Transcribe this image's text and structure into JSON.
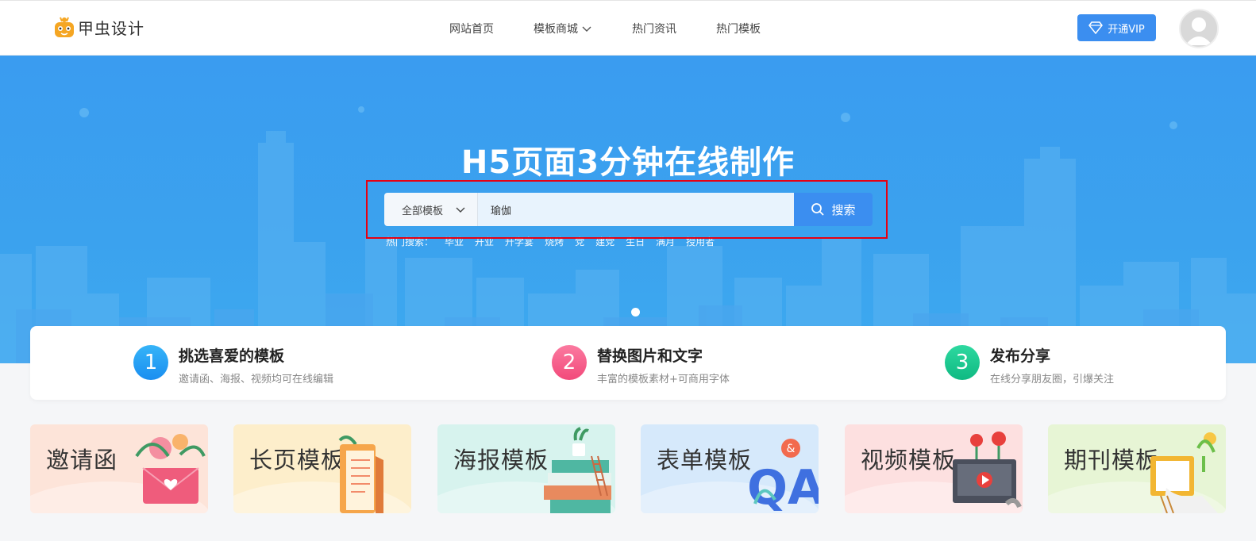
{
  "header": {
    "logo_text": "甲虫设计",
    "nav": [
      {
        "label": "网站首页"
      },
      {
        "label": "模板商城",
        "has_dropdown": true
      },
      {
        "label": "热门资讯"
      },
      {
        "label": "热门模板"
      }
    ],
    "vip_label": "开通VIP"
  },
  "hero": {
    "title": "H5页面3分钟在线制作",
    "search": {
      "category": "全部模板",
      "query": "瑜伽",
      "button_label": "搜索"
    },
    "hot_label": "热门搜索：",
    "hot_items": [
      "毕业",
      "开业",
      "升学宴",
      "烧烤",
      "党",
      "建党",
      "生日",
      "满月",
      "授用者"
    ],
    "carousel": {
      "slides_shown": 1,
      "active": 1
    }
  },
  "steps": [
    {
      "num": "1",
      "title": "挑选喜爱的模板",
      "desc": "邀请函、海报、视频均可在线编辑",
      "color": "#1e9af2"
    },
    {
      "num": "2",
      "title": "替换图片和文字",
      "desc": "丰富的模板素材+可商用字体",
      "color": "#f2557e"
    },
    {
      "num": "3",
      "title": "发布分享",
      "desc": "在线分享朋友圈，引爆关注",
      "color": "#13c28a"
    }
  ],
  "categories": [
    {
      "label": "邀请函",
      "bg": "#fde4d9",
      "icon": "envelope-icon"
    },
    {
      "label": "长页模板",
      "bg": "#fdeecb",
      "icon": "scroll-icon"
    },
    {
      "label": "海报模板",
      "bg": "#d7f3ee",
      "icon": "books-icon"
    },
    {
      "label": "表单模板",
      "bg": "#d6e9fb",
      "icon": "qa-icon"
    },
    {
      "label": "视频模板",
      "bg": "#fde0e0",
      "icon": "video-icon"
    },
    {
      "label": "期刊模板",
      "bg": "#e7f5d5",
      "icon": "magazine-icon"
    }
  ],
  "colors": {
    "accent": "#3b8ef0",
    "hero_bg": "#3a9cf0",
    "highlight_border": "#e60012"
  }
}
